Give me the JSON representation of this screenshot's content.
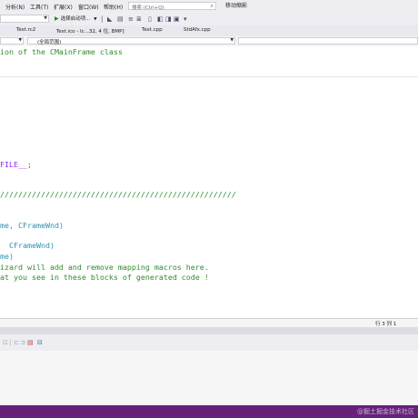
{
  "menu": {
    "items": [
      "分析(N)",
      "工具(T)",
      "扩展(X)",
      "窗口(W)",
      "帮助(H)"
    ],
    "search_placeholder": "搜索 (Ctrl+Q)",
    "dev_badge": "移动缩影"
  },
  "toolbar": {
    "run_label": "选择启动项..."
  },
  "tabs": [
    "Test.rc2",
    "Test.ico - Ic...32, 4 位, BMP]",
    "Test.cpp",
    "StdAfx.cpp"
  ],
  "navbar": {
    "scope_label": "(全局范围)"
  },
  "code": {
    "line1": "ion of the CMainFrame class",
    "line2": "FILE__;",
    "line3": "////////////////////////////////////////////////////",
    "line4a": "me, ",
    "line4b": "CFrameWnd)",
    "line5": "  CFrameWnd)",
    "line6": "me)",
    "line7": "izard will add and remove mapping macros here.",
    "line8": "at you see in these blocks of generated code !"
  },
  "status": {
    "line_col": "行 3    列 1"
  },
  "watermark": "@掘土掘金技术社区"
}
